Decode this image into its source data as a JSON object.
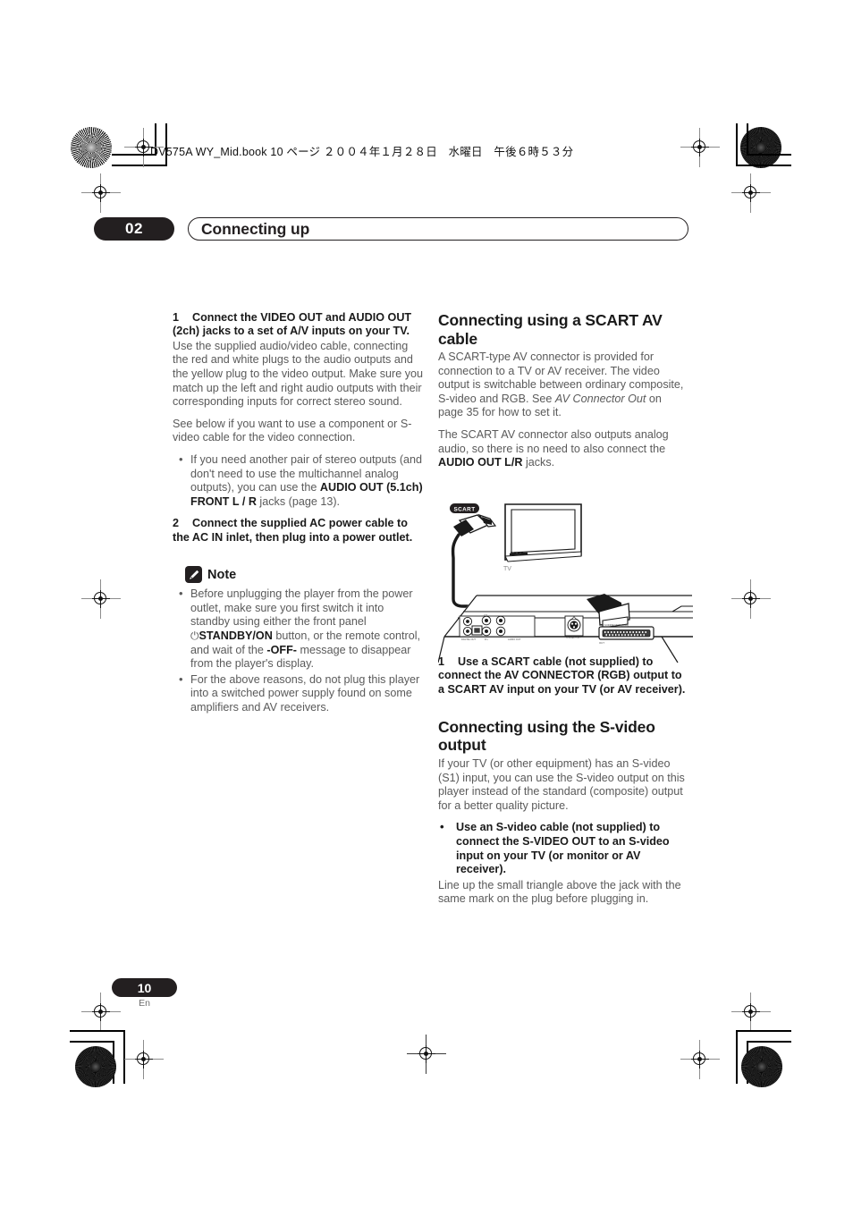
{
  "header": {
    "book_line": "DV575A WY_Mid.book  10 ページ  ２００４年１月２８日　水曜日　午後６時５３分"
  },
  "chapter": {
    "number": "02",
    "title": "Connecting up"
  },
  "left_column": {
    "step1": {
      "num": "1",
      "heading": "Connect the VIDEO OUT and AUDIO OUT (2ch) jacks to a set of A/V inputs on your TV.",
      "body": "Use the supplied audio/video cable, connecting the red and white plugs to the audio outputs and the yellow plug to the video output. Make sure you match up the left and right audio outputs with their corresponding inputs for correct stereo sound.",
      "body2": "See below if you want to use a component or S-video cable for the video connection."
    },
    "bullet1": {
      "part1": "If you need another pair of stereo outputs (and don't need to use the multichannel analog outputs), you can use the ",
      "bold": "AUDIO OUT (5.1ch) FRONT L / R",
      "part2": " jacks (page 13)."
    },
    "step2": {
      "num": "2",
      "heading": "Connect the supplied AC power cable to the AC IN inlet, then plug into a power outlet."
    },
    "note": {
      "label": "Note",
      "icon": "pencil-icon",
      "bullet1_part1": "Before unplugging the player from the power outlet, make sure you first switch it into standby using either the front panel ",
      "bullet1_power_symbol": "⏻",
      "bullet1_bold1": "STANDBY/ON",
      "bullet1_part2": " button, or the remote control, and wait of the ",
      "bullet1_bold2": "-OFF-",
      "bullet1_part3": " message to disappear from the player's display.",
      "bullet2": "For the above reasons, do not plug this player into a switched power supply found on some amplifiers and AV receivers."
    }
  },
  "right_column": {
    "scart_section": {
      "heading": "Connecting using a SCART AV cable",
      "para1_part1": "A SCART-type AV connector is provided for connection to a TV or AV receiver. The video output is switchable between ordinary composite, S-video and RGB. See ",
      "para1_italic": "AV Connector Out",
      "para1_part2": " on page 35 for how to set it.",
      "para2_part1": "The SCART AV connector also outputs analog audio, so there is no need to also connect the ",
      "para2_bold": "AUDIO OUT L/R",
      "para2_part2": " jacks."
    },
    "figure": {
      "scart_label": "SCART",
      "tv_label": "TV"
    },
    "scart_step": {
      "num": "1",
      "text": "Use a SCART cable (not supplied) to connect the AV CONNECTOR (RGB) output to a SCART AV input on your TV (or AV receiver)."
    },
    "svideo_section": {
      "heading": "Connecting using the S-video output",
      "para1": "If your TV (or other equipment) has an S-video (S1) input, you can use the S-video output on this player instead of the standard (composite) output for a better quality picture.",
      "bullet_bold": "Use an S-video cable (not supplied) to connect the S-VIDEO OUT to an S-video input on your TV (or monitor or AV receiver).",
      "para2": "Line up the small triangle above the jack with the same mark on the plug before plugging in."
    }
  },
  "footer": {
    "page_number": "10",
    "language": "En"
  },
  "colors": {
    "ink_black": "#231f20",
    "body_gray": "#5a5a5a",
    "heading_black": "#1a1a1a"
  }
}
